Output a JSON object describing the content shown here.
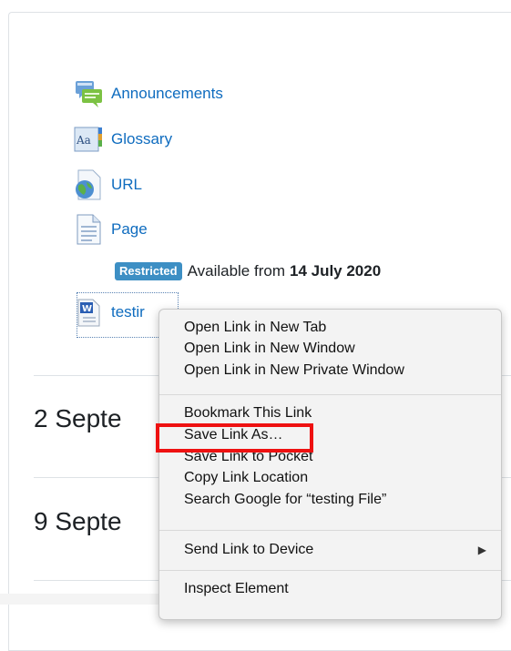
{
  "activities": [
    {
      "label": "Announcements",
      "icon": "forum-icon"
    },
    {
      "label": "Glossary",
      "icon": "glossary-icon"
    },
    {
      "label": "URL",
      "icon": "url-globe-icon"
    },
    {
      "label": "Page",
      "icon": "page-icon"
    }
  ],
  "restriction": {
    "badge": "Restricted",
    "text": "Available from",
    "date": "14 July 2020"
  },
  "file_link": {
    "label": "testir",
    "icon": "word-document-icon"
  },
  "sections": [
    "2 Septe",
    "9 Septe"
  ],
  "context_menu": {
    "group1": [
      "Open Link in New Tab",
      "Open Link in New Window",
      "Open Link in New Private Window"
    ],
    "group2": [
      "Bookmark This Link",
      "Save Link As…",
      "Save Link to Pocket",
      "Copy Link Location",
      "Search Google for “testing File”"
    ],
    "group3": [
      "Send Link to Device"
    ],
    "group4": [
      "Inspect Element"
    ]
  },
  "colors": {
    "link": "#0f6cbf",
    "badge": "#3d8fc4",
    "highlight": "#ee1111"
  }
}
